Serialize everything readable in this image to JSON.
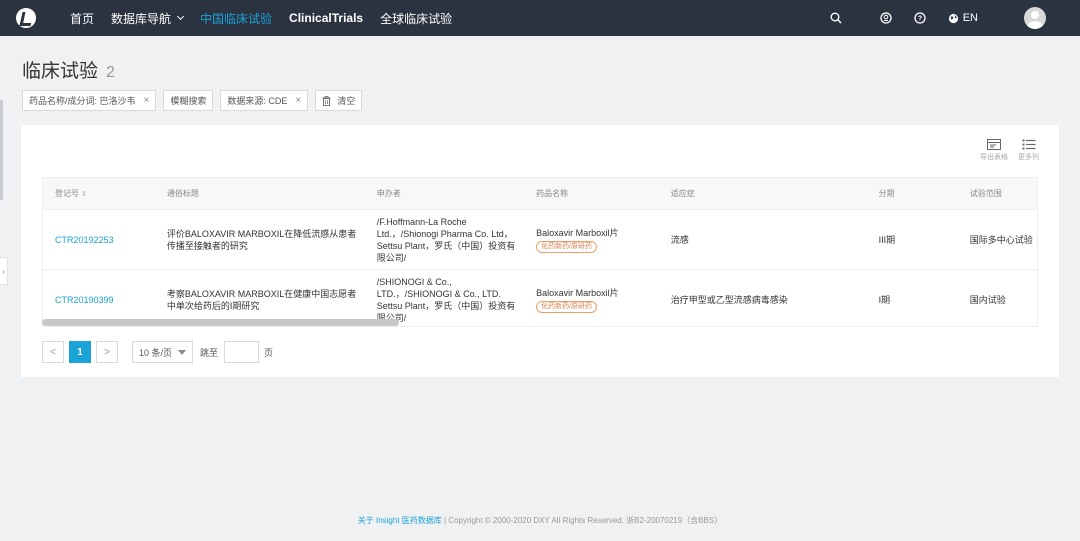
{
  "nav": {
    "items": [
      {
        "label": "首页",
        "active": false
      },
      {
        "label": "数据库导航",
        "active": false,
        "dropdown": true
      },
      {
        "label": "中国临床试验",
        "active": true
      },
      {
        "label": "ClinicalTrials",
        "active": false
      },
      {
        "label": "全球临床试验",
        "active": false
      }
    ],
    "lang": "EN"
  },
  "page": {
    "title": "临床试验",
    "count": "2"
  },
  "filters": [
    {
      "label": "药品名称/成分词: 巴洛沙韦",
      "close": "×"
    },
    {
      "label": "模糊搜索",
      "close": ""
    },
    {
      "label": "数据来源: CDE",
      "close": "×"
    }
  ],
  "clear_label": "清空",
  "tools": {
    "export": "导出表格",
    "more_cols": "更多列"
  },
  "table": {
    "headers": [
      "登记号",
      "通俗标题",
      "申办者",
      "药品名称",
      "适应症",
      "分期",
      "试验范围"
    ],
    "rows": [
      {
        "id": "CTR20192253",
        "title": "评价BALOXAVIR MARBOXIL在降低流感从患者传播至接触者的研究",
        "sponsor": "/F.Hoffmann-La Roche Ltd.，/Shionogi Pharma Co. Ltd，Settsu Plant，罗氏（中国）投资有限公司/",
        "drug": "Baloxavir Marboxil片",
        "drug_tag": "化药新药/原研药",
        "indication": "流感",
        "phase": "III期",
        "scope": "国际多中心试验"
      },
      {
        "id": "CTR20190399",
        "title": "考察BALOXAVIR MARBOXIL在健康中国志愿者中单次给药后的I期研究",
        "sponsor": "/SHIONOGI & Co., LTD.，/SHIONOGI & Co., LTD. Settsu Plant，罗氏（中国）投资有限公司/",
        "drug": "Baloxavir Marboxil片",
        "drug_tag": "化药新药/原研药",
        "indication": "治疗甲型或乙型流感病毒感染",
        "phase": "I期",
        "scope": "国内试验"
      }
    ]
  },
  "pager": {
    "prev": "<",
    "current": "1",
    "next": ">",
    "page_size": "10 条/页",
    "jump_label": "跳至",
    "jump_suffix": "页"
  },
  "footer": {
    "link": "关于 Insight 医药数据库",
    "separator": "|",
    "text": "Copyright © 2000-2020 DXY All Rights Reserved. 浙B2-20070219（含BBS）"
  },
  "colors": {
    "nav_bg": "#2b3240",
    "accent": "#1aa3d6",
    "tag": "#d9804a"
  }
}
